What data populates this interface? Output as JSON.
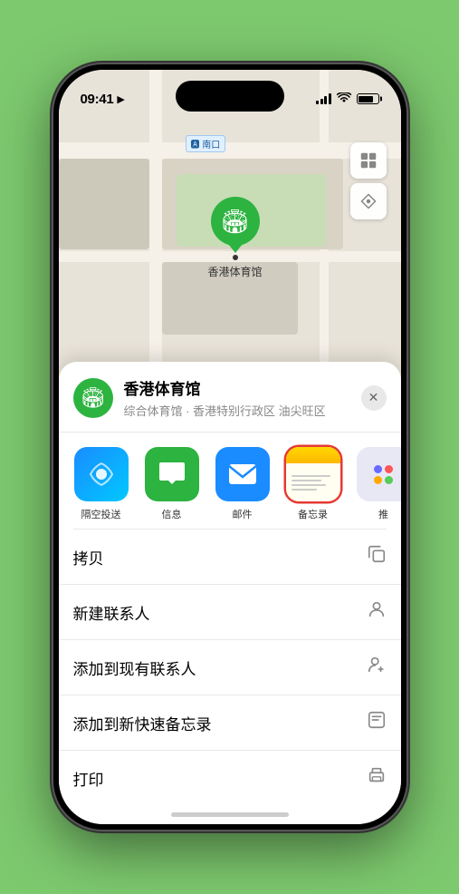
{
  "status_bar": {
    "time": "09:41",
    "direction_icon": "▶",
    "battery_level": "80"
  },
  "map": {
    "label": "南口",
    "pin_name": "香港体育馆",
    "controls": {
      "layers_icon": "🗺",
      "location_icon": "↗"
    }
  },
  "location_header": {
    "name": "香港体育馆",
    "subtitle": "综合体育馆 · 香港特别行政区 油尖旺区",
    "close_label": "✕"
  },
  "share_apps": [
    {
      "id": "airdrop",
      "label": "隔空投送",
      "bg": "airdrop"
    },
    {
      "id": "messages",
      "label": "信息",
      "bg": "messages"
    },
    {
      "id": "mail",
      "label": "邮件",
      "bg": "mail"
    },
    {
      "id": "notes",
      "label": "备忘录",
      "bg": "notes"
    },
    {
      "id": "more",
      "label": "推",
      "bg": "more"
    }
  ],
  "actions": [
    {
      "id": "copy",
      "label": "拷贝",
      "icon": "⧉"
    },
    {
      "id": "new-contact",
      "label": "新建联系人",
      "icon": "👤"
    },
    {
      "id": "add-existing",
      "label": "添加到现有联系人",
      "icon": "👤"
    },
    {
      "id": "add-notes",
      "label": "添加到新快速备忘录",
      "icon": "🗒"
    },
    {
      "id": "print",
      "label": "打印",
      "icon": "🖨"
    }
  ],
  "colors": {
    "green": "#2db340",
    "blue": "#1a8cff",
    "red": "#e53935",
    "notes_yellow": "#ffd700"
  }
}
